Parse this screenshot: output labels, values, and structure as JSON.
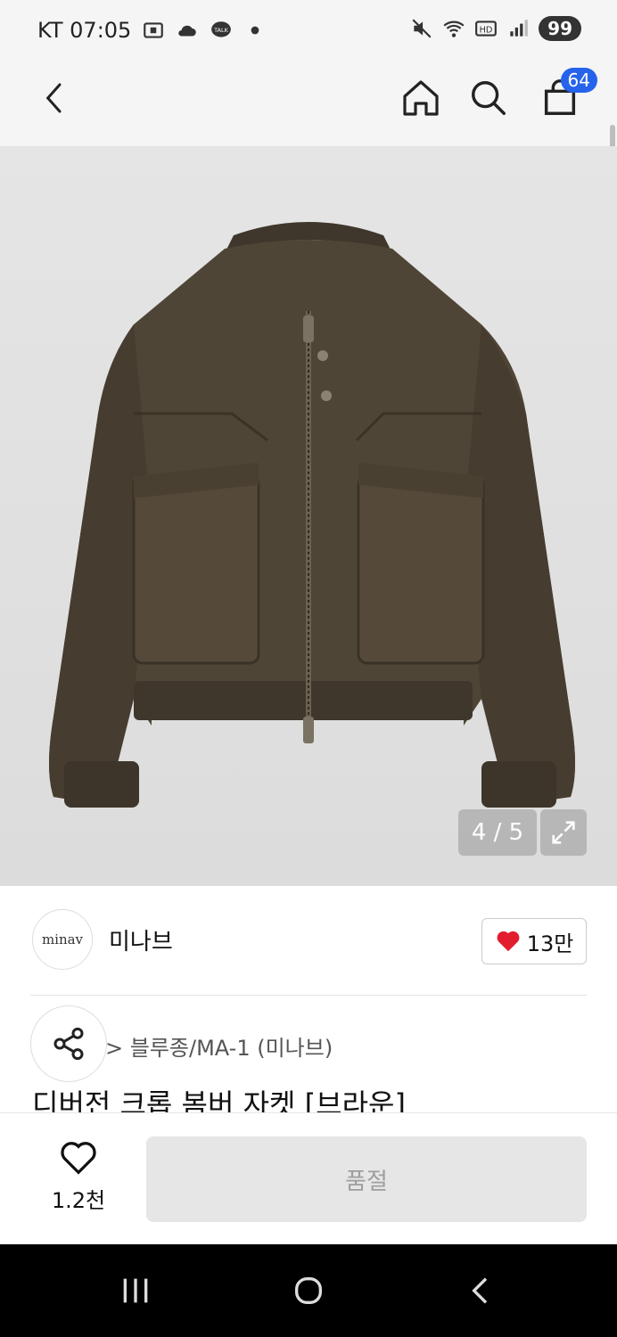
{
  "status_bar": {
    "carrier_time": "KT 07:05",
    "battery": "99"
  },
  "nav": {
    "cart_count": "64",
    "icons": [
      "back-icon",
      "home-icon",
      "search-icon",
      "shopping-bag-icon"
    ]
  },
  "gallery": {
    "counter": "4 / 5"
  },
  "brand": {
    "logo_text": "minav",
    "name": "미나브",
    "likes": "13만"
  },
  "product": {
    "category": "블루종/MA-1 (미나브)",
    "title": "디버전 크롭 봄버 자켓 [브라운]"
  },
  "bottom": {
    "wish_count": "1.2천",
    "buy_label": "품절"
  },
  "colors": {
    "accent": "#2563eb",
    "heart": "#e11d2e",
    "jacket": "#4f4536"
  }
}
